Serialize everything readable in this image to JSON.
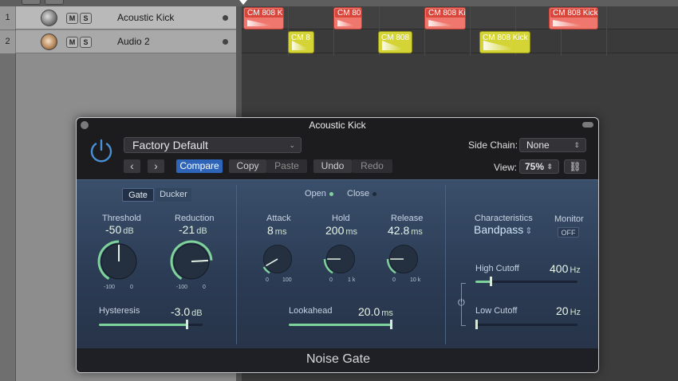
{
  "tracks": [
    {
      "num": "1",
      "mute": "M",
      "solo": "S",
      "name": "Acoustic Kick"
    },
    {
      "num": "2",
      "mute": "M",
      "solo": "S",
      "name": "Audio 2"
    }
  ],
  "regions": {
    "lane1": [
      "CM 808 K",
      "CM 80",
      "CM 808 Ki",
      "CM 808 Kick"
    ],
    "lane2": [
      "CM 8",
      "CM 808",
      "CM 808 Kick"
    ]
  },
  "plugin": {
    "title": "Acoustic Kick",
    "preset": "Factory Default",
    "prev": "‹",
    "next": "›",
    "compare": "Compare",
    "copy": "Copy",
    "paste": "Paste",
    "undo": "Undo",
    "redo": "Redo",
    "side_chain_label": "Side Chain:",
    "side_chain_value": "None",
    "view_label": "View:",
    "view_value": "75%",
    "name": "Noise Gate",
    "mode": {
      "gate": "Gate",
      "ducker": "Ducker"
    },
    "threshold": {
      "label": "Threshold",
      "value": "-50",
      "unit": "dB",
      "min": "-100",
      "max": "0",
      "level": 0.5
    },
    "reduction": {
      "label": "Reduction",
      "value": "-21",
      "unit": "dB",
      "min": "-100",
      "max": "0",
      "level": 0.79
    },
    "hysteresis": {
      "label": "Hysteresis",
      "value": "-3.0",
      "unit": "dB",
      "level": 0.85
    },
    "open_label": "Open",
    "close_label": "Close",
    "attack": {
      "label": "Attack",
      "value": "8",
      "unit": "ms",
      "min": "0",
      "max": "100",
      "level": 0.1
    },
    "hold": {
      "label": "Hold",
      "value": "200",
      "unit": "ms",
      "min": "0",
      "max": "1 k",
      "level": 0.2
    },
    "release": {
      "label": "Release",
      "value": "42.8",
      "unit": "ms",
      "min": "0",
      "max": "10 k",
      "level": 0.2
    },
    "lookahead": {
      "label": "Lookahead",
      "value": "20.0",
      "unit": "ms",
      "level": 1.0
    },
    "characteristics_label": "Characteristics",
    "characteristics_value": "Bandpass",
    "monitor_label": "Monitor",
    "monitor_value": "OFF",
    "high_cutoff": {
      "label": "High Cutoff",
      "value": "400",
      "unit": "Hz",
      "level": 0.15
    },
    "low_cutoff": {
      "label": "Low Cutoff",
      "value": "20",
      "unit": "Hz",
      "level": 0.0
    },
    "accent_color": "#7ed39a",
    "compare_color": "#2f65b8"
  }
}
